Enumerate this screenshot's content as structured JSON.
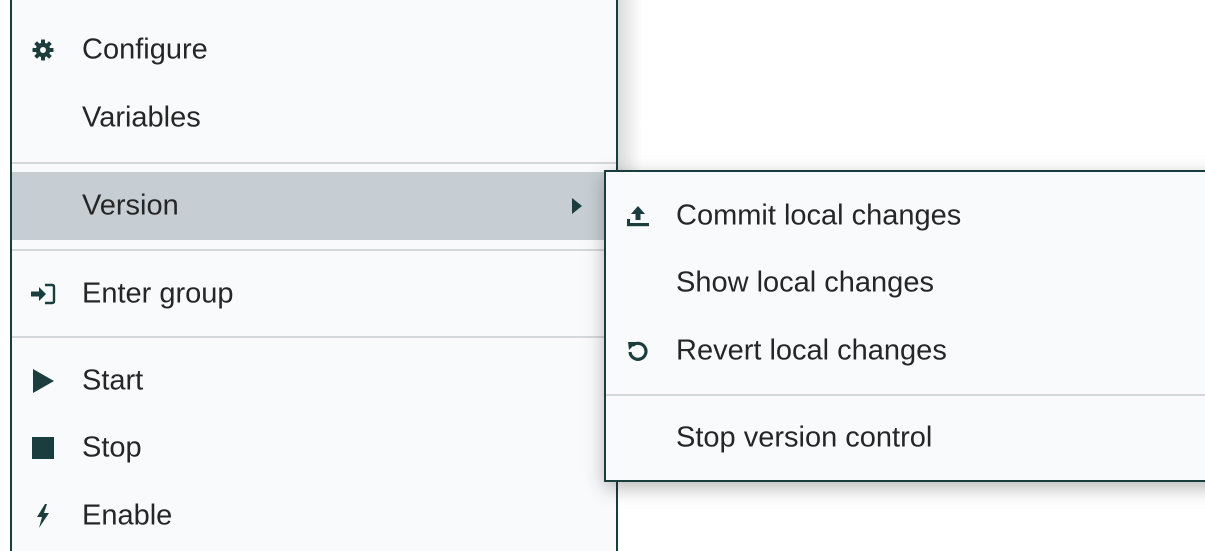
{
  "main_menu": {
    "items": [
      {
        "label": "Configure",
        "icon": "gear-icon"
      },
      {
        "label": "Variables",
        "icon": ""
      },
      {
        "label": "Version",
        "icon": "",
        "has_submenu": true,
        "highlighted": true
      },
      {
        "label": "Enter group",
        "icon": "enter-group-icon"
      },
      {
        "label": "Start",
        "icon": "play-icon"
      },
      {
        "label": "Stop",
        "icon": "stop-icon"
      },
      {
        "label": "Enable",
        "icon": "lightning-icon"
      }
    ]
  },
  "submenu": {
    "items": [
      {
        "label": "Commit local changes",
        "icon": "upload-icon"
      },
      {
        "label": "Show local changes",
        "icon": ""
      },
      {
        "label": "Revert local changes",
        "icon": "undo-icon"
      },
      {
        "label": "Stop version control",
        "icon": ""
      }
    ]
  },
  "colors": {
    "accent": "#1c3d3d",
    "menu_background": "#f9fafb",
    "highlight": "#c7ced3",
    "divider": "#d3d8db",
    "text": "#262626"
  }
}
